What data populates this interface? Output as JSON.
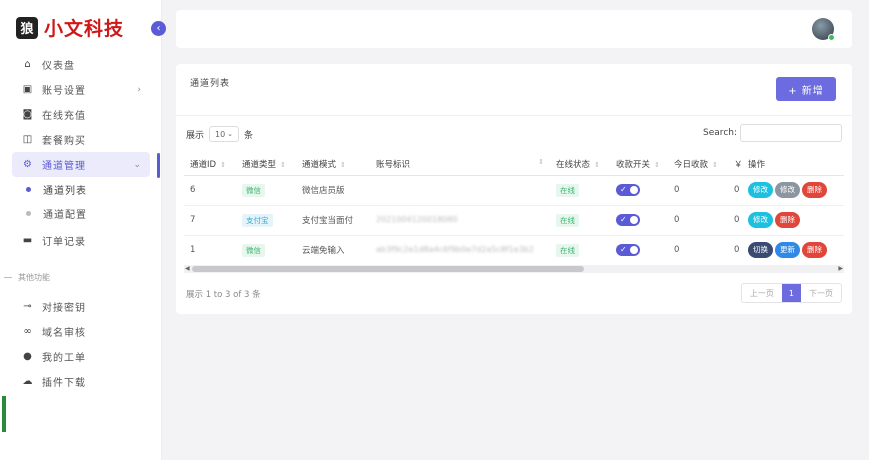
{
  "brand": {
    "logo_icon": "wolf-logo",
    "name": "小文科技"
  },
  "sidebar": {
    "items": [
      {
        "label": "仪表盘",
        "icon": "home-icon"
      },
      {
        "label": "账号设置",
        "icon": "account-card-icon",
        "has_arrow": true
      },
      {
        "label": "在线充值",
        "icon": "recharge-icon"
      },
      {
        "label": "套餐购买",
        "icon": "package-icon"
      },
      {
        "label": "通道管理",
        "icon": "gear-icon",
        "active": true
      }
    ],
    "subitems": [
      {
        "label": "通道列表",
        "active": true
      },
      {
        "label": "通道配置",
        "active": false
      }
    ],
    "more_items": [
      {
        "label": "订单记录",
        "icon": "wallet-icon"
      }
    ],
    "section_label": "其他功能",
    "other_items": [
      {
        "label": "对接密钥",
        "icon": "key-icon"
      },
      {
        "label": "域名审核",
        "icon": "link-icon"
      },
      {
        "label": "我的工单",
        "icon": "chat-icon"
      },
      {
        "label": "插件下载",
        "icon": "cloud-download-icon"
      }
    ]
  },
  "card": {
    "title": "通道列表",
    "add_label": "+ 新增",
    "show_prefix": "展示",
    "show_value": "10",
    "show_suffix": "条",
    "search_label": "Search:",
    "search_value": "",
    "info": "展示 1 to 3 of 3 条",
    "pager": {
      "prev": "上一页",
      "current": "1",
      "next": "下一页"
    }
  },
  "table": {
    "headers": [
      "通道ID",
      "通道类型",
      "通道模式",
      "账号标识",
      "在线状态",
      "收款开关",
      "今日收款",
      "￥",
      "操作"
    ],
    "rows": [
      {
        "id": "6",
        "type": "微信",
        "type_class": "wx",
        "mode": "微信店员版",
        "account": "",
        "status": "在线",
        "today": "0",
        "yen": "0",
        "actions": [
          {
            "label": "修改",
            "color": "c"
          },
          {
            "label": "修改",
            "color": "g"
          },
          {
            "label": "删除",
            "color": "r"
          }
        ]
      },
      {
        "id": "7",
        "type": "支付宝",
        "type_class": "ali",
        "mode": "支付宝当面付",
        "account": "2021004120018080",
        "status": "在线",
        "today": "0",
        "yen": "0",
        "actions": [
          {
            "label": "修改",
            "color": "c"
          },
          {
            "label": "删除",
            "color": "r"
          }
        ]
      },
      {
        "id": "1",
        "type": "微信",
        "type_class": "wx",
        "mode": "云端免输入",
        "account": "ab3f9c2e1d8a4c6f9b0e7d2a5c8f1e3b2",
        "status": "在线",
        "today": "0",
        "yen": "0",
        "actions": [
          {
            "label": "切换",
            "color": "d"
          },
          {
            "label": "更新",
            "color": "b"
          },
          {
            "label": "删除",
            "color": "r"
          }
        ]
      }
    ]
  },
  "colors": {
    "accent": "#5b5bd6",
    "brand_red": "#d01818",
    "online_green": "#3cb371"
  }
}
